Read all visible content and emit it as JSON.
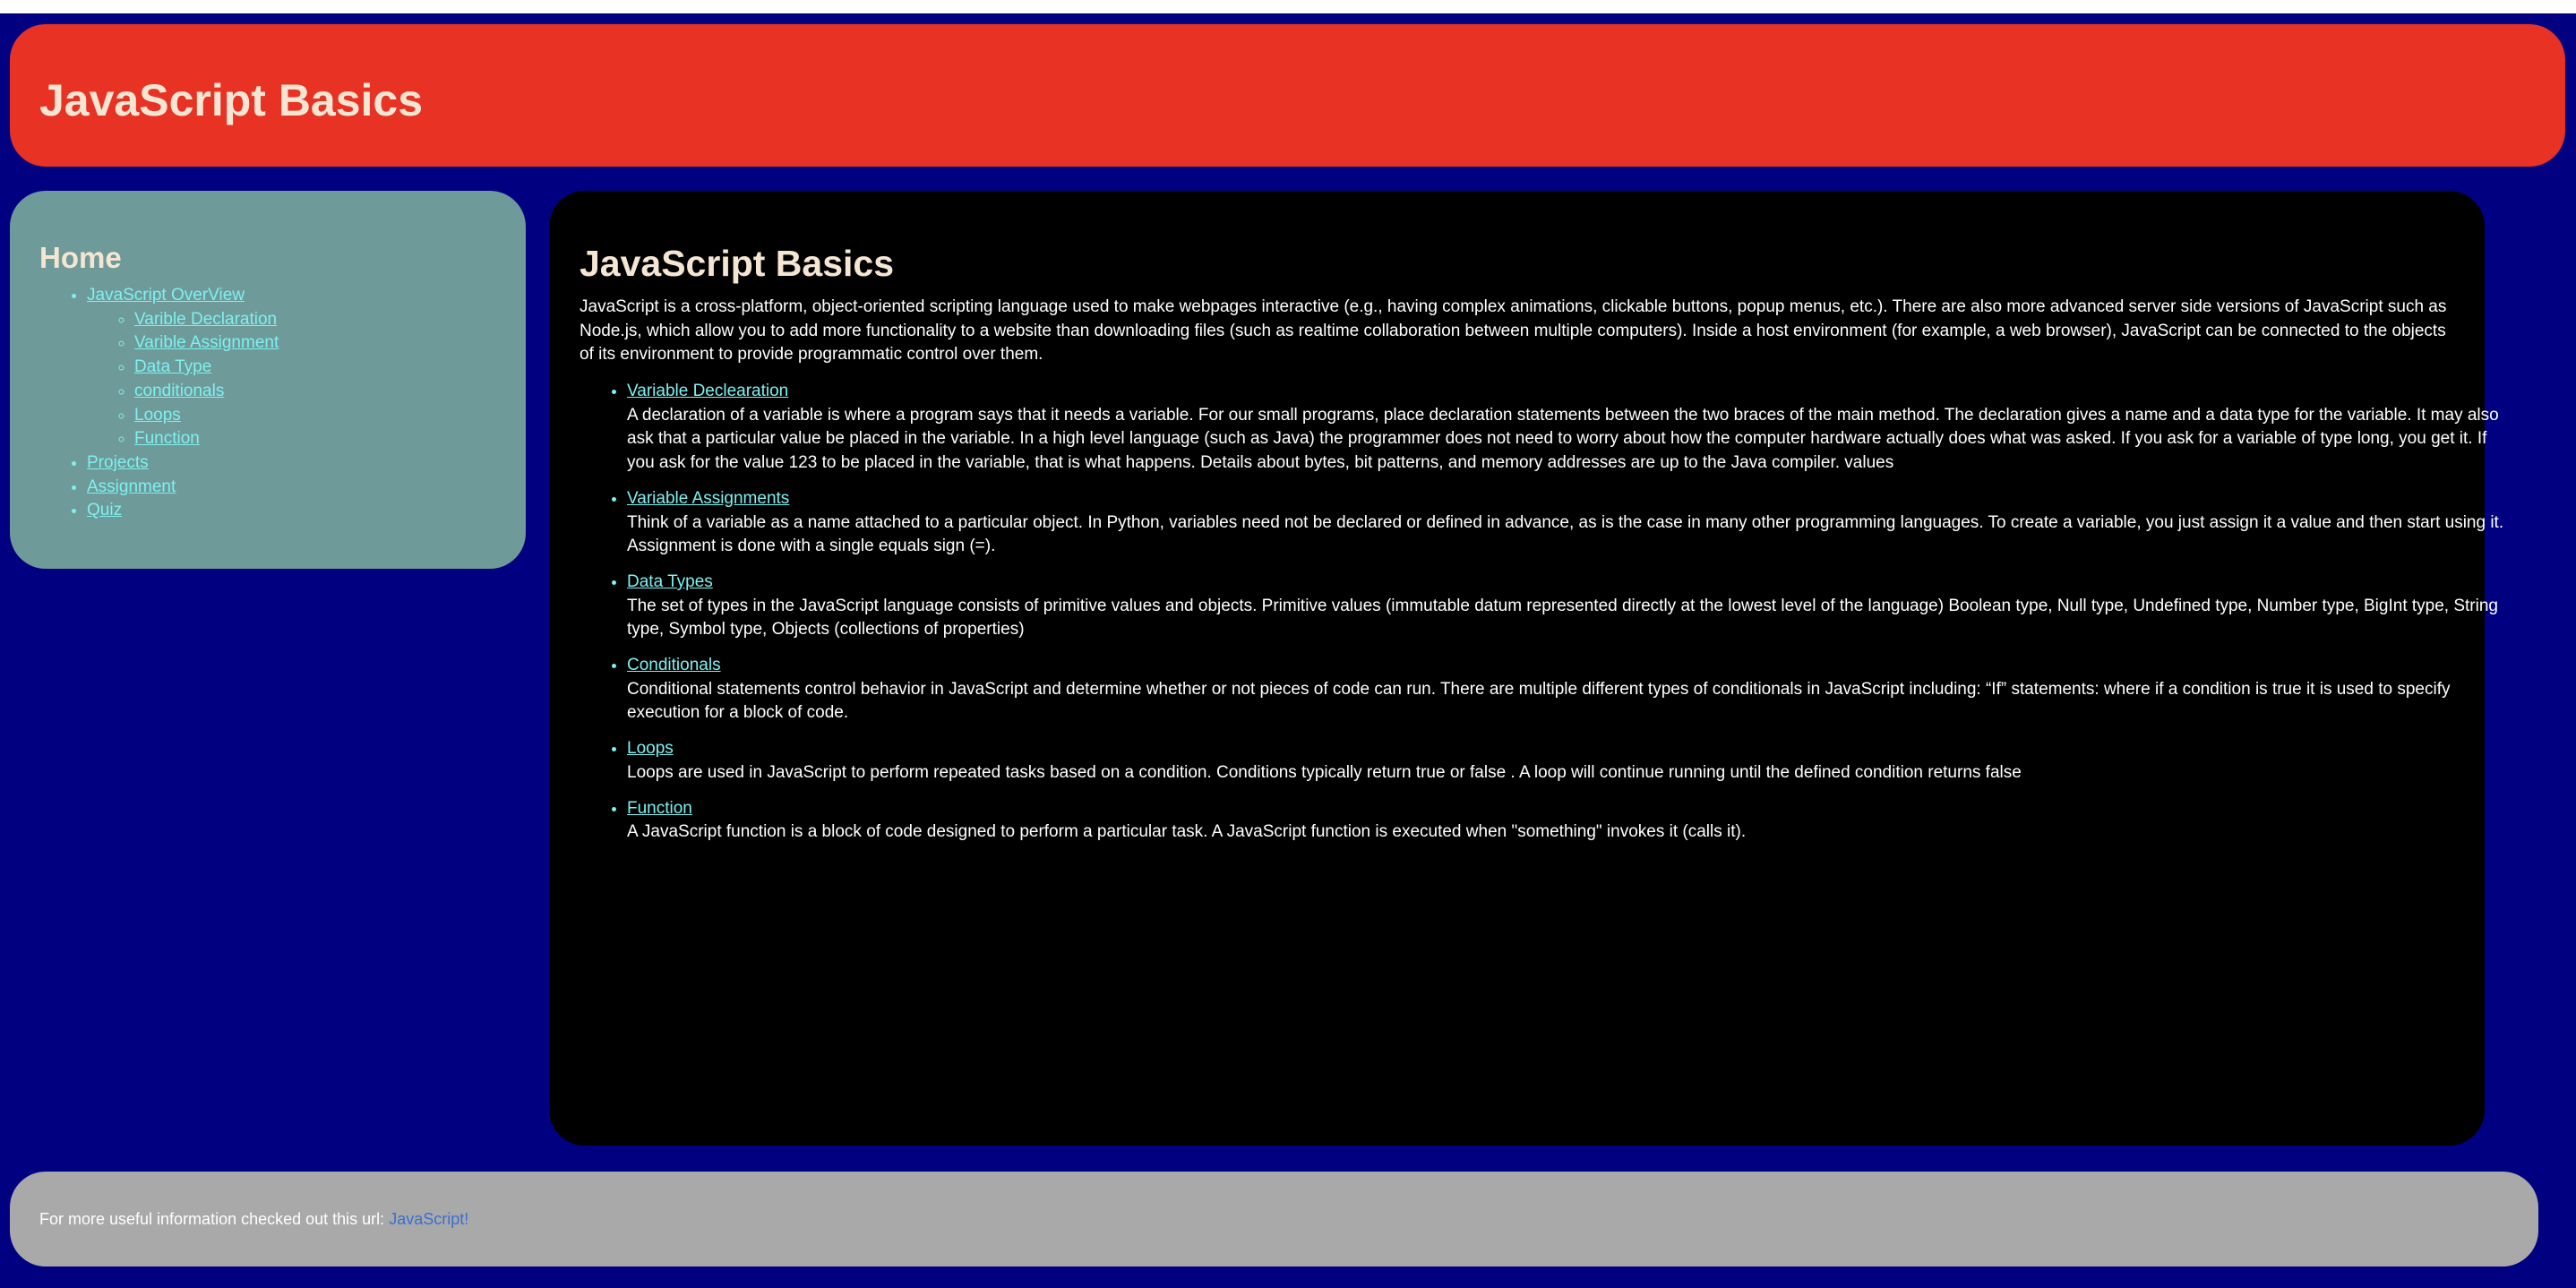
{
  "header": {
    "title": "JavaScript Basics"
  },
  "sidebar": {
    "heading": "Home",
    "overview": {
      "label": "JavaScript OverView",
      "children": [
        "Varible Declaration",
        "Varible Assignment",
        "Data Type",
        "conditionals",
        "Loops",
        "Function"
      ]
    },
    "items": [
      "Projects",
      "Assignment",
      "Quiz"
    ]
  },
  "main": {
    "title": "JavaScript Basics",
    "intro": "JavaScript is a cross-platform, object-oriented scripting language used to make webpages interactive (e.g., having complex animations, clickable buttons, popup menus, etc.). There are also more advanced server side versions of JavaScript such as Node.js, which allow you to add more functionality to a website than downloading files (such as realtime collaboration between multiple computers). Inside a host environment (for example, a web browser), JavaScript can be connected to the objects of its environment to provide programmatic control over them.",
    "topics": [
      {
        "link": "Variable Declearation",
        "desc": "A declaration of a variable is where a program says that it needs a variable. For our small programs, place declaration statements between the two braces of the main method. The declaration gives a name and a data type for the variable. It may also ask that a particular value be placed in the variable. In a high level language (such as Java) the programmer does not need to worry about how the computer hardware actually does what was asked. If you ask for a variable of type long, you get it. If you ask for the value 123 to be placed in the variable, that is what happens. Details about bytes, bit patterns, and memory addresses are up to the Java compiler. values"
      },
      {
        "link": "Variable Assignments",
        "desc": "Think of a variable as a name attached to a particular object. In Python, variables need not be declared or defined in advance, as is the case in many other programming languages. To create a variable, you just assign it a value and then start using it. Assignment is done with a single equals sign (=)."
      },
      {
        "link": "Data Types",
        "desc": "The set of types in the JavaScript language consists of primitive values and objects. Primitive values (immutable datum represented directly at the lowest level of the language) Boolean type, Null type, Undefined type, Number type, BigInt type, String type, Symbol type, Objects (collections of properties)"
      },
      {
        "link": "Conditionals",
        "desc": "Conditional statements control behavior in JavaScript and determine whether or not pieces of code can run. There are multiple different types of conditionals in JavaScript including: “If” statements: where if a condition is true it is used to specify execution for a block of code."
      },
      {
        "link": "Loops",
        "desc": "Loops are used in JavaScript to perform repeated tasks based on a condition. Conditions typically return true or false . A loop will continue running until the defined condition returns false"
      },
      {
        "link": "Function",
        "desc": "A JavaScript function is a block of code designed to perform a particular task. A JavaScript function is executed when \"something\" invokes it (calls it)."
      }
    ]
  },
  "footer": {
    "text": "For more useful information checked out this url: ",
    "link": "JavaScript!"
  },
  "colors": {
    "page_background": "#000080",
    "header_background": "#e83224",
    "sidebar_background": "#6e9a9a",
    "main_background": "#000000",
    "footer_background": "#a9a9a9",
    "heading_text": "#f5e6d3",
    "link_text": "#7ff0f0",
    "footer_link": "#3a6fd0"
  }
}
